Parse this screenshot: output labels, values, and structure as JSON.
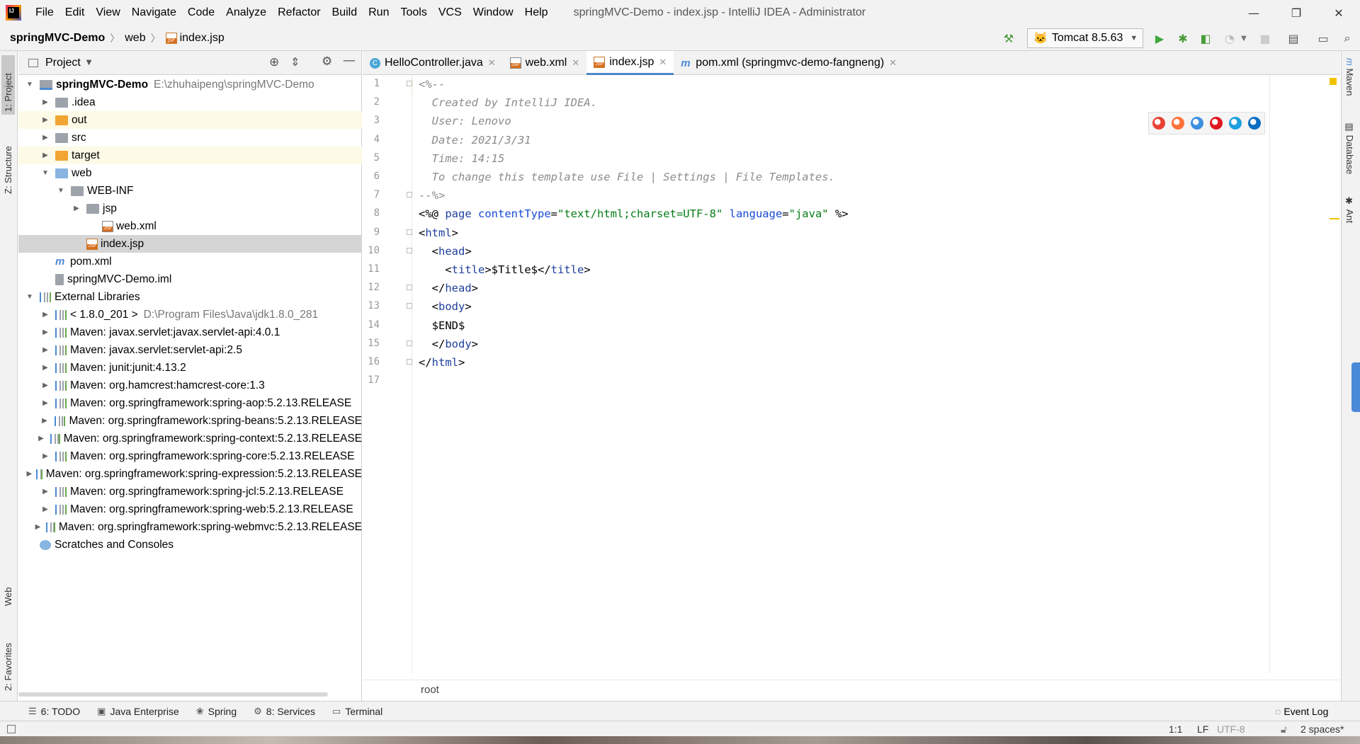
{
  "window": {
    "title": "springMVC-Demo - index.jsp - IntelliJ IDEA - Administrator",
    "menu": [
      "File",
      "Edit",
      "View",
      "Navigate",
      "Code",
      "Analyze",
      "Refactor",
      "Build",
      "Run",
      "Tools",
      "VCS",
      "Window",
      "Help"
    ],
    "controls": {
      "minimize": "—",
      "restore": "❐",
      "close": "✕"
    }
  },
  "breadcrumb": [
    "springMVC-Demo",
    "web",
    "index.jsp"
  ],
  "toolbar": {
    "run_config": "Tomcat 8.5.63"
  },
  "left_stripe": {
    "project": "1: Project",
    "structure": "Z: Structure",
    "web": "Web",
    "favorites": "2: Favorites"
  },
  "project_panel": {
    "title": "Project",
    "tree": [
      {
        "label": "springMVC-Demo",
        "extra": "E:\\zhuhaipeng\\springMVC-Demo",
        "indent": 0,
        "arrow": "▼",
        "icon": "root",
        "bold": true
      },
      {
        "label": ".idea",
        "indent": 1,
        "arrow": "▶",
        "icon": "grey"
      },
      {
        "label": "out",
        "indent": 1,
        "arrow": "▶",
        "icon": "orange",
        "highlight": true
      },
      {
        "label": "src",
        "indent": 1,
        "arrow": "▶",
        "icon": "grey"
      },
      {
        "label": "target",
        "indent": 1,
        "arrow": "▶",
        "icon": "orange",
        "highlight": true
      },
      {
        "label": "web",
        "indent": 1,
        "arrow": "▼",
        "icon": "blue"
      },
      {
        "label": "WEB-INF",
        "indent": 2,
        "arrow": "▼",
        "icon": "grey"
      },
      {
        "label": "jsp",
        "indent": 3,
        "arrow": "▶",
        "icon": "grey"
      },
      {
        "label": "web.xml",
        "indent": 4,
        "arrow": "",
        "icon": "xml"
      },
      {
        "label": "index.jsp",
        "indent": 3,
        "arrow": "",
        "icon": "jsp",
        "selected": true
      },
      {
        "label": "pom.xml",
        "indent": 1,
        "arrow": "",
        "icon": "maven"
      },
      {
        "label": "springMVC-Demo.iml",
        "indent": 1,
        "arrow": "",
        "icon": "iml"
      },
      {
        "label": "External Libraries",
        "indent": 0,
        "arrow": "▼",
        "icon": "lib"
      },
      {
        "label": "< 1.8.0_201 >",
        "extra": "D:\\Program Files\\Java\\jdk1.8.0_281",
        "indent": 1,
        "arrow": "▶",
        "icon": "jdk"
      },
      {
        "label": "Maven: javax.servlet:javax.servlet-api:4.0.1",
        "indent": 1,
        "arrow": "▶",
        "icon": "lib"
      },
      {
        "label": "Maven: javax.servlet:servlet-api:2.5",
        "indent": 1,
        "arrow": "▶",
        "icon": "lib"
      },
      {
        "label": "Maven: junit:junit:4.13.2",
        "indent": 1,
        "arrow": "▶",
        "icon": "lib"
      },
      {
        "label": "Maven: org.hamcrest:hamcrest-core:1.3",
        "indent": 1,
        "arrow": "▶",
        "icon": "lib"
      },
      {
        "label": "Maven: org.springframework:spring-aop:5.2.13.RELEASE",
        "indent": 1,
        "arrow": "▶",
        "icon": "lib"
      },
      {
        "label": "Maven: org.springframework:spring-beans:5.2.13.RELEASE",
        "indent": 1,
        "arrow": "▶",
        "icon": "lib"
      },
      {
        "label": "Maven: org.springframework:spring-context:5.2.13.RELEASE",
        "indent": 1,
        "arrow": "▶",
        "icon": "lib"
      },
      {
        "label": "Maven: org.springframework:spring-core:5.2.13.RELEASE",
        "indent": 1,
        "arrow": "▶",
        "icon": "lib"
      },
      {
        "label": "Maven: org.springframework:spring-expression:5.2.13.RELEASE",
        "indent": 1,
        "arrow": "▶",
        "icon": "lib"
      },
      {
        "label": "Maven: org.springframework:spring-jcl:5.2.13.RELEASE",
        "indent": 1,
        "arrow": "▶",
        "icon": "lib"
      },
      {
        "label": "Maven: org.springframework:spring-web:5.2.13.RELEASE",
        "indent": 1,
        "arrow": "▶",
        "icon": "lib"
      },
      {
        "label": "Maven: org.springframework:spring-webmvc:5.2.13.RELEASE",
        "indent": 1,
        "arrow": "▶",
        "icon": "lib"
      },
      {
        "label": "Scratches and Consoles",
        "indent": 0,
        "arrow": "",
        "icon": "scratch"
      }
    ]
  },
  "tabs": [
    {
      "label": "HelloController.java",
      "icon": "c"
    },
    {
      "label": "web.xml",
      "icon": "xml"
    },
    {
      "label": "index.jsp",
      "icon": "jsp",
      "active": true
    },
    {
      "label": "pom.xml (springmvc-demo-fangneng)",
      "icon": "m"
    }
  ],
  "editor": {
    "line_numbers": [
      "1",
      "2",
      "3",
      "4",
      "5",
      "6",
      "7",
      "8",
      "9",
      "10",
      "11",
      "12",
      "13",
      "14",
      "15",
      "16",
      "17"
    ],
    "lines": [
      [
        {
          "t": "<%--",
          "c": "cmt"
        }
      ],
      [
        {
          "t": "  Created by IntelliJ IDEA.",
          "c": "cmt"
        }
      ],
      [
        {
          "t": "  User: Lenovo",
          "c": "cmt"
        }
      ],
      [
        {
          "t": "  Date: 2021/3/31",
          "c": "cmt"
        }
      ],
      [
        {
          "t": "  Time: 14:15",
          "c": "cmt"
        }
      ],
      [
        {
          "t": "  To change this template use File | Settings | File Templates.",
          "c": "cmt"
        }
      ],
      [
        {
          "t": "--%>",
          "c": "cmt"
        }
      ],
      [
        {
          "t": "<%@ ",
          "c": "dir"
        },
        {
          "t": "page ",
          "c": "tag"
        },
        {
          "t": "contentType",
          "c": "attr"
        },
        {
          "t": "=",
          "c": "plain"
        },
        {
          "t": "\"text/html;charset=UTF-8\"",
          "c": "str"
        },
        {
          "t": " ",
          "c": "plain"
        },
        {
          "t": "language",
          "c": "attr"
        },
        {
          "t": "=",
          "c": "plain"
        },
        {
          "t": "\"java\"",
          "c": "str"
        },
        {
          "t": " %>",
          "c": "dir"
        }
      ],
      [
        {
          "t": "<",
          "c": "plain"
        },
        {
          "t": "html",
          "c": "tag"
        },
        {
          "t": ">",
          "c": "plain"
        }
      ],
      [
        {
          "t": "  <",
          "c": "plain"
        },
        {
          "t": "head",
          "c": "tag"
        },
        {
          "t": ">",
          "c": "plain"
        }
      ],
      [
        {
          "t": "    <",
          "c": "plain"
        },
        {
          "t": "title",
          "c": "tag"
        },
        {
          "t": ">$Title$</",
          "c": "plain"
        },
        {
          "t": "title",
          "c": "tag"
        },
        {
          "t": ">",
          "c": "plain"
        }
      ],
      [
        {
          "t": "  </",
          "c": "plain"
        },
        {
          "t": "head",
          "c": "tag"
        },
        {
          "t": ">",
          "c": "plain"
        }
      ],
      [
        {
          "t": "  <",
          "c": "plain"
        },
        {
          "t": "body",
          "c": "tag"
        },
        {
          "t": ">",
          "c": "plain"
        }
      ],
      [
        {
          "t": "  $END$",
          "c": "plain"
        }
      ],
      [
        {
          "t": "  </",
          "c": "plain"
        },
        {
          "t": "body",
          "c": "tag"
        },
        {
          "t": ">",
          "c": "plain"
        }
      ],
      [
        {
          "t": "</",
          "c": "plain"
        },
        {
          "t": "html",
          "c": "tag"
        },
        {
          "t": ">",
          "c": "plain"
        }
      ],
      [
        {
          "t": "",
          "c": "plain"
        }
      ]
    ],
    "footer_crumb": "root"
  },
  "browsers": [
    {
      "name": "chrome-icon",
      "color": "#e94235"
    },
    {
      "name": "firefox-icon",
      "color": "#ff7139"
    },
    {
      "name": "safari-icon",
      "color": "#3d8fe0"
    },
    {
      "name": "opera-icon",
      "color": "#e0161f"
    },
    {
      "name": "ie-icon",
      "color": "#1d9fe0"
    },
    {
      "name": "edge-icon",
      "color": "#0a6fc2"
    }
  ],
  "right_stripe": {
    "maven": "Maven",
    "database": "Database",
    "ant": "Ant"
  },
  "bottom_tabs": [
    {
      "label": "6: TODO",
      "icon": "☰"
    },
    {
      "label": "Java Enterprise",
      "icon": "▣"
    },
    {
      "label": "Spring",
      "icon": "❀"
    },
    {
      "label": "8: Services",
      "icon": "⚙"
    },
    {
      "label": "Terminal",
      "icon": "▭"
    }
  ],
  "event_log": "Event Log",
  "status": {
    "position": "1:1",
    "line_sep": "LF",
    "encoding": "UTF-8",
    "indent": "2 spaces*"
  }
}
